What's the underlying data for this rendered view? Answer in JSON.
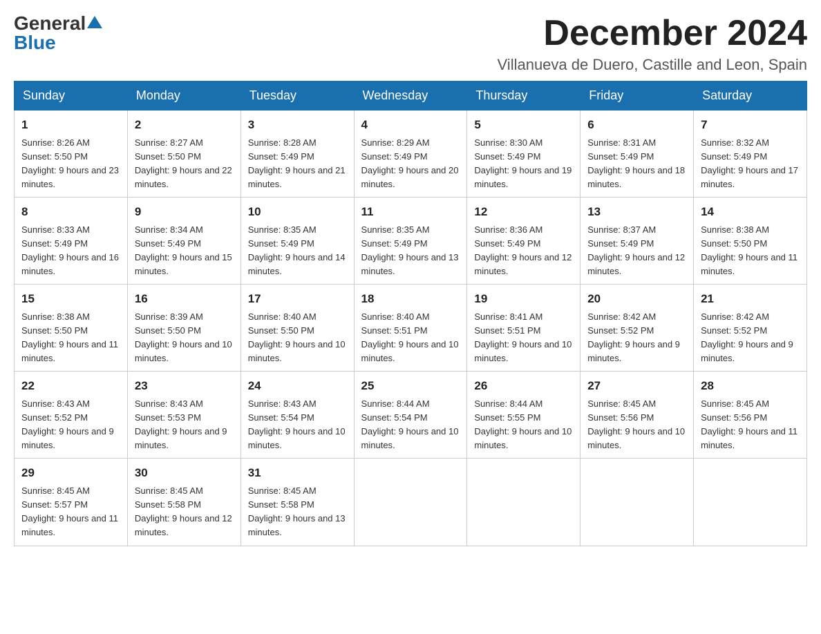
{
  "logo": {
    "general": "General",
    "blue": "Blue"
  },
  "title": "December 2024",
  "location": "Villanueva de Duero, Castille and Leon, Spain",
  "days_of_week": [
    "Sunday",
    "Monday",
    "Tuesday",
    "Wednesday",
    "Thursday",
    "Friday",
    "Saturday"
  ],
  "weeks": [
    [
      {
        "day": "1",
        "sunrise": "8:26 AM",
        "sunset": "5:50 PM",
        "daylight": "9 hours and 23 minutes."
      },
      {
        "day": "2",
        "sunrise": "8:27 AM",
        "sunset": "5:50 PM",
        "daylight": "9 hours and 22 minutes."
      },
      {
        "day": "3",
        "sunrise": "8:28 AM",
        "sunset": "5:49 PM",
        "daylight": "9 hours and 21 minutes."
      },
      {
        "day": "4",
        "sunrise": "8:29 AM",
        "sunset": "5:49 PM",
        "daylight": "9 hours and 20 minutes."
      },
      {
        "day": "5",
        "sunrise": "8:30 AM",
        "sunset": "5:49 PM",
        "daylight": "9 hours and 19 minutes."
      },
      {
        "day": "6",
        "sunrise": "8:31 AM",
        "sunset": "5:49 PM",
        "daylight": "9 hours and 18 minutes."
      },
      {
        "day": "7",
        "sunrise": "8:32 AM",
        "sunset": "5:49 PM",
        "daylight": "9 hours and 17 minutes."
      }
    ],
    [
      {
        "day": "8",
        "sunrise": "8:33 AM",
        "sunset": "5:49 PM",
        "daylight": "9 hours and 16 minutes."
      },
      {
        "day": "9",
        "sunrise": "8:34 AM",
        "sunset": "5:49 PM",
        "daylight": "9 hours and 15 minutes."
      },
      {
        "day": "10",
        "sunrise": "8:35 AM",
        "sunset": "5:49 PM",
        "daylight": "9 hours and 14 minutes."
      },
      {
        "day": "11",
        "sunrise": "8:35 AM",
        "sunset": "5:49 PM",
        "daylight": "9 hours and 13 minutes."
      },
      {
        "day": "12",
        "sunrise": "8:36 AM",
        "sunset": "5:49 PM",
        "daylight": "9 hours and 12 minutes."
      },
      {
        "day": "13",
        "sunrise": "8:37 AM",
        "sunset": "5:49 PM",
        "daylight": "9 hours and 12 minutes."
      },
      {
        "day": "14",
        "sunrise": "8:38 AM",
        "sunset": "5:50 PM",
        "daylight": "9 hours and 11 minutes."
      }
    ],
    [
      {
        "day": "15",
        "sunrise": "8:38 AM",
        "sunset": "5:50 PM",
        "daylight": "9 hours and 11 minutes."
      },
      {
        "day": "16",
        "sunrise": "8:39 AM",
        "sunset": "5:50 PM",
        "daylight": "9 hours and 10 minutes."
      },
      {
        "day": "17",
        "sunrise": "8:40 AM",
        "sunset": "5:50 PM",
        "daylight": "9 hours and 10 minutes."
      },
      {
        "day": "18",
        "sunrise": "8:40 AM",
        "sunset": "5:51 PM",
        "daylight": "9 hours and 10 minutes."
      },
      {
        "day": "19",
        "sunrise": "8:41 AM",
        "sunset": "5:51 PM",
        "daylight": "9 hours and 10 minutes."
      },
      {
        "day": "20",
        "sunrise": "8:42 AM",
        "sunset": "5:52 PM",
        "daylight": "9 hours and 9 minutes."
      },
      {
        "day": "21",
        "sunrise": "8:42 AM",
        "sunset": "5:52 PM",
        "daylight": "9 hours and 9 minutes."
      }
    ],
    [
      {
        "day": "22",
        "sunrise": "8:43 AM",
        "sunset": "5:52 PM",
        "daylight": "9 hours and 9 minutes."
      },
      {
        "day": "23",
        "sunrise": "8:43 AM",
        "sunset": "5:53 PM",
        "daylight": "9 hours and 9 minutes."
      },
      {
        "day": "24",
        "sunrise": "8:43 AM",
        "sunset": "5:54 PM",
        "daylight": "9 hours and 10 minutes."
      },
      {
        "day": "25",
        "sunrise": "8:44 AM",
        "sunset": "5:54 PM",
        "daylight": "9 hours and 10 minutes."
      },
      {
        "day": "26",
        "sunrise": "8:44 AM",
        "sunset": "5:55 PM",
        "daylight": "9 hours and 10 minutes."
      },
      {
        "day": "27",
        "sunrise": "8:45 AM",
        "sunset": "5:56 PM",
        "daylight": "9 hours and 10 minutes."
      },
      {
        "day": "28",
        "sunrise": "8:45 AM",
        "sunset": "5:56 PM",
        "daylight": "9 hours and 11 minutes."
      }
    ],
    [
      {
        "day": "29",
        "sunrise": "8:45 AM",
        "sunset": "5:57 PM",
        "daylight": "9 hours and 11 minutes."
      },
      {
        "day": "30",
        "sunrise": "8:45 AM",
        "sunset": "5:58 PM",
        "daylight": "9 hours and 12 minutes."
      },
      {
        "day": "31",
        "sunrise": "8:45 AM",
        "sunset": "5:58 PM",
        "daylight": "9 hours and 13 minutes."
      },
      null,
      null,
      null,
      null
    ]
  ]
}
